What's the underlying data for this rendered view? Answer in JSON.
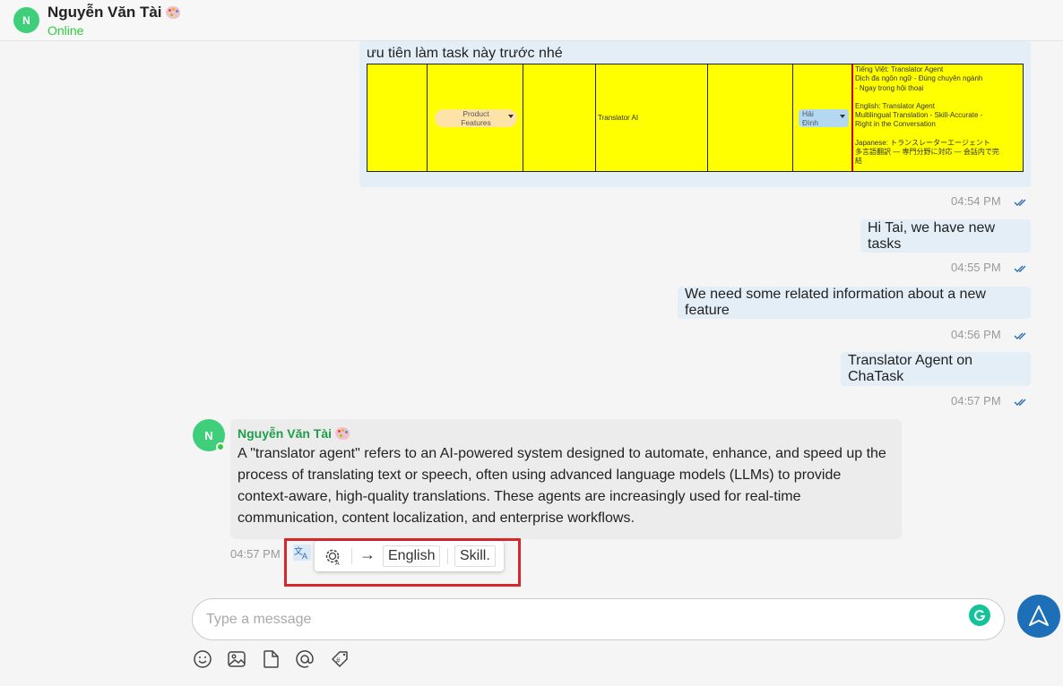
{
  "header": {
    "avatar_initials": "N\u0001",
    "name": "Nguyễn Văn Tài",
    "status": "Online",
    "status_color": "#2ecc40"
  },
  "messages": {
    "sheet_caption": "ưu tiên làm task này trước nhé",
    "sheet": {
      "chip_product": "Product\nFeatures",
      "translator_ai": "Translator AI",
      "chip_person": "Hải\nĐình",
      "desc_vi_1": "Tiếng Việt: Translator Agent",
      "desc_vi_2": "Dịch đa ngôn ngữ - Đúng chuyên ngành",
      "desc_vi_3": "- Ngay trong hội thoại",
      "desc_en_1": "English: Translator Agent",
      "desc_en_2": "Multilingual Translation - Skill-Accurate -",
      "desc_en_3": "Right in the Conversation",
      "desc_ja_1": "Japanese: トランスレーターエージェント",
      "desc_ja_2": "多言語翻訳 — 専門分野に対応 — 会話内で完",
      "desc_ja_3": "結"
    },
    "time_1": "04:54 PM",
    "msg_2": "Hi Tai, we have new tasks",
    "time_2": "04:55 PM",
    "msg_3": "We need some related information about a new feature",
    "time_3": "04:56 PM",
    "msg_4": "Translator Agent on ChaTask",
    "time_4": "04:57 PM"
  },
  "incoming": {
    "avatar_initials": "N\u0001",
    "sender": "Nguyễn Văn Tài",
    "text": "A \"translator agent\" refers to an AI-powered system designed to automate, enhance, and speed up the process of translating text or speech, often using advanced language models (LLMs) to provide context-aware, high-quality translations. These agents are increasingly used for real-time communication, content localization, and enterprise workflows.",
    "time": "04:57 PM"
  },
  "translate_toolbar": {
    "arrow": "→",
    "language": "English",
    "skill": "Skill."
  },
  "composer": {
    "placeholder": "Type a message"
  },
  "colors": {
    "accent": "#1d6fb8",
    "outgoing_bubble": "#e3eef7",
    "highlight": "#d9262c"
  }
}
